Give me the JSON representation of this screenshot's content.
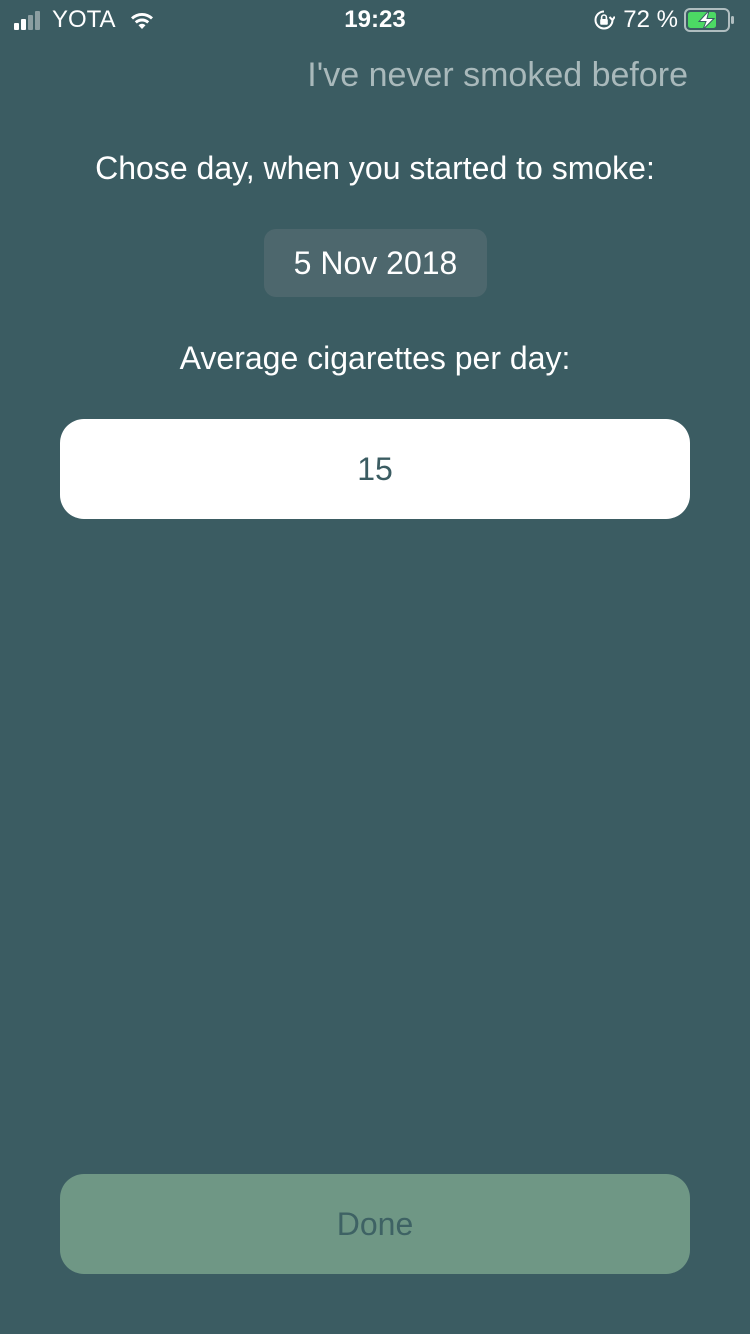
{
  "status_bar": {
    "carrier": "YOTA",
    "time": "19:23",
    "battery_percent": "72 %",
    "signal_bars_filled": 2,
    "signal_bars_total": 4,
    "icons": [
      "signal-icon",
      "wifi-icon",
      "orientation-lock-icon",
      "battery-charging-icon"
    ]
  },
  "header": {
    "never_smoked_label": "I've never smoked before"
  },
  "start_date": {
    "label": "Chose day, when you started to smoke:",
    "value": "5 Nov 2018"
  },
  "cigarettes": {
    "label": "Average cigarettes per day:",
    "value": "15"
  },
  "footer": {
    "done_label": "Done"
  },
  "colors": {
    "background": "#3b5c62",
    "date_pill": "#4d676d",
    "input_background": "#ffffff",
    "done_button": "#6f9785",
    "done_text": "#3e6264",
    "muted_link": "#a9b9bb",
    "battery_fill": "#4cd964"
  }
}
